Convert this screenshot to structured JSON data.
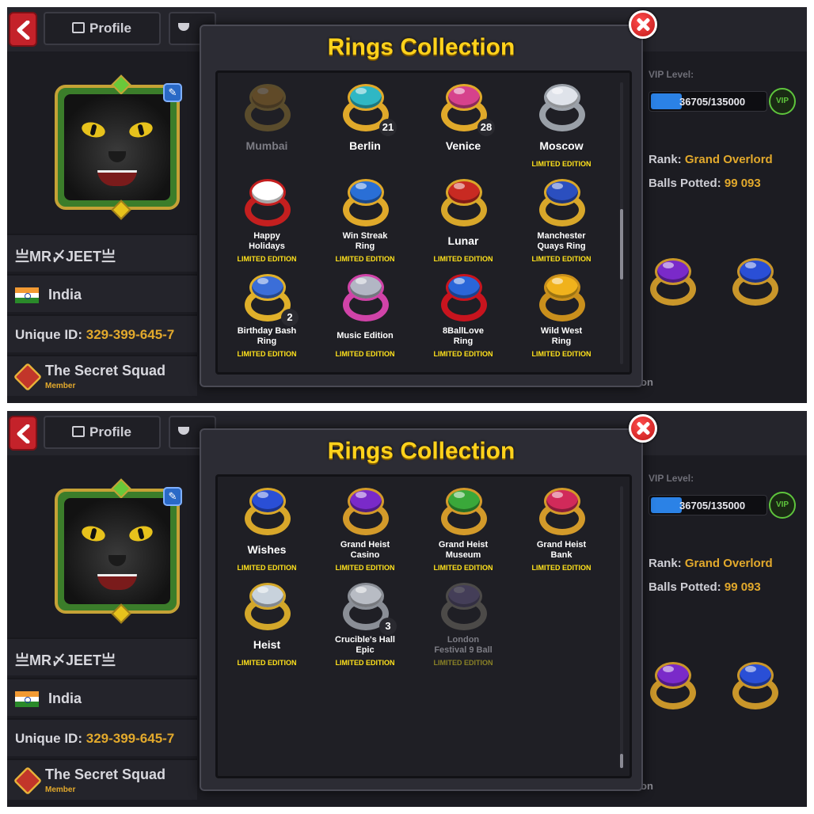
{
  "screens": [
    {
      "topbar": {
        "profile_tab": "Profile"
      },
      "player": {
        "name": "亗MR〆JEET亗",
        "country": "India",
        "unique_id_label": "Unique ID:",
        "unique_id": "329-399-645-7",
        "club_name": "The Secret Squad",
        "club_role": "Member"
      },
      "stats": {
        "vip_label": "VIP Level:",
        "vip_progress": "36705/135000",
        "vip_progress_fraction": 0.27,
        "vip_badge": "VIP",
        "rank_label": "Rank:",
        "rank_value": "Grand Overlord",
        "balls_label": "Balls Potted:",
        "balls_value": "99 093",
        "partial_text": "on"
      },
      "modal": {
        "title": "Rings Collection",
        "scroll_position": 0.6,
        "scroll_thumb_fraction": 0.25,
        "rings": [
          {
            "name": [
              "Mumbai"
            ],
            "edition": "",
            "count": "",
            "locked": true,
            "top_color": "#d99a2e",
            "band_color": "#c9a13a"
          },
          {
            "name": [
              "Berlin"
            ],
            "edition": "",
            "count": "21",
            "locked": false,
            "top_color": "#2fb7c4",
            "band_color": "#e0a92a"
          },
          {
            "name": [
              "Venice"
            ],
            "edition": "",
            "count": "28",
            "locked": false,
            "top_color": "#d6428c",
            "band_color": "#e0a92a"
          },
          {
            "name": [
              "Moscow"
            ],
            "edition": "LIMITED EDITION",
            "count": "",
            "locked": false,
            "top_color": "#dfe3ea",
            "band_color": "#9aa0a8"
          },
          {
            "name": [
              "Happy",
              "Holidays"
            ],
            "edition": "LIMITED EDITION",
            "count": "",
            "locked": false,
            "top_color": "#ffffff",
            "band_color": "#c41f1f"
          },
          {
            "name": [
              "Win Streak",
              "Ring"
            ],
            "edition": "LIMITED EDITION",
            "count": "",
            "locked": false,
            "top_color": "#2a6fd6",
            "band_color": "#e0a92a"
          },
          {
            "name": [
              "Lunar"
            ],
            "edition": "LIMITED EDITION",
            "count": "",
            "locked": false,
            "top_color": "#c82a22",
            "band_color": "#d8a72a"
          },
          {
            "name": [
              "Manchester",
              "Quays Ring"
            ],
            "edition": "LIMITED EDITION",
            "count": "",
            "locked": false,
            "top_color": "#2b4fbf",
            "band_color": "#d8a72a"
          },
          {
            "name": [
              "Birthday Bash",
              "Ring"
            ],
            "edition": "LIMITED EDITION",
            "count": "2",
            "locked": false,
            "top_color": "#3b6ed8",
            "band_color": "#e0b02a"
          },
          {
            "name": [
              "Music Edition"
            ],
            "edition": "LIMITED EDITION",
            "count": "",
            "locked": false,
            "top_color": "#b2b6c4",
            "band_color": "#d043a8"
          },
          {
            "name": [
              "8BallLove",
              "Ring"
            ],
            "edition": "LIMITED EDITION",
            "count": "",
            "locked": false,
            "top_color": "#2a66d8",
            "band_color": "#c8141e"
          },
          {
            "name": [
              "Wild West",
              "Ring"
            ],
            "edition": "LIMITED EDITION",
            "count": "",
            "locked": false,
            "top_color": "#f0b21c",
            "band_color": "#c98f1c"
          }
        ]
      }
    },
    {
      "topbar": {
        "profile_tab": "Profile"
      },
      "player": {
        "name": "亗MR〆JEET亗",
        "country": "India",
        "unique_id_label": "Unique ID:",
        "unique_id": "329-399-645-7",
        "club_name": "The Secret Squad",
        "club_role": "Member"
      },
      "stats": {
        "vip_label": "VIP Level:",
        "vip_progress": "36705/135000",
        "vip_progress_fraction": 0.27,
        "vip_badge": "VIP",
        "rank_label": "Rank:",
        "rank_value": "Grand Overlord",
        "balls_label": "Balls Potted:",
        "balls_value": "99 093",
        "partial_text": "on"
      },
      "modal": {
        "title": "Rings Collection",
        "scroll_position": 1.0,
        "scroll_thumb_fraction": 0.05,
        "rings": [
          {
            "name": [
              "Wishes"
            ],
            "edition": "LIMITED EDITION",
            "count": "",
            "locked": false,
            "top_color": "#2a4fd6",
            "band_color": "#d8a72a"
          },
          {
            "name": [
              "Grand Heist",
              "Casino"
            ],
            "edition": "LIMITED EDITION",
            "count": "",
            "locked": false,
            "top_color": "#7a2ac9",
            "band_color": "#d39a2a"
          },
          {
            "name": [
              "Grand Heist",
              "Museum"
            ],
            "edition": "LIMITED EDITION",
            "count": "",
            "locked": false,
            "top_color": "#3aa83a",
            "band_color": "#d39a2a"
          },
          {
            "name": [
              "Grand Heist",
              "Bank"
            ],
            "edition": "LIMITED EDITION",
            "count": "",
            "locked": false,
            "top_color": "#d12a5a",
            "band_color": "#d39a2a"
          },
          {
            "name": [
              "Heist"
            ],
            "edition": "LIMITED EDITION",
            "count": "",
            "locked": false,
            "top_color": "#c8d2dc",
            "band_color": "#d3a72a"
          },
          {
            "name": [
              "Crucible's Hall",
              "Epic"
            ],
            "edition": "LIMITED EDITION",
            "count": "3",
            "locked": false,
            "top_color": "#b8bcc4",
            "band_color": "#8a8e96"
          },
          {
            "name": [
              "London",
              "Festival 9 Ball"
            ],
            "edition": "LIMITED EDITION",
            "count": "",
            "locked": true,
            "top_color": "#8a7ab8",
            "band_color": "#a09a8a"
          }
        ]
      }
    }
  ],
  "side_ring_colors": [
    {
      "top": "#7a2ac9",
      "band": "#c9962a"
    },
    {
      "top": "#2a4fd6",
      "band": "#c9962a"
    }
  ]
}
